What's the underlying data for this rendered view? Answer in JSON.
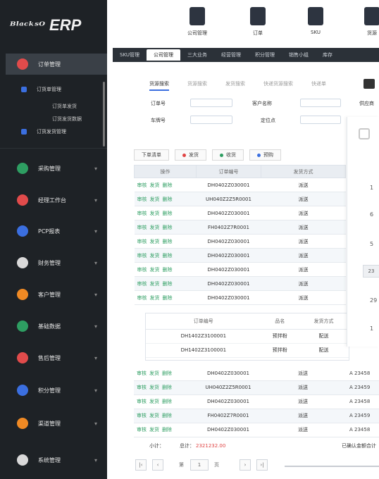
{
  "app": {
    "logo_mark": "ᴮˡᵃᶜᵏˢᴼ",
    "logo_text": "ERP"
  },
  "colors": {
    "sidebar": "#1e2226",
    "tabbar": "#2b3138",
    "accent": "#3b6fe0",
    "op_link": "#2e9e62",
    "total": "#e04444"
  },
  "sidebar": {
    "active": {
      "label": "订单管理",
      "icon": "order-icon",
      "color": "#e14b4b"
    },
    "sub_items": [
      {
        "label": "订货单管理"
      },
      {
        "label": "订货发货管理"
      }
    ],
    "sub_sub": [
      "订货单发货",
      "订货发货数据"
    ],
    "items": [
      {
        "label": "采购管理",
        "icon": "purchase-icon",
        "color": "#2e9e62"
      },
      {
        "label": "经理工作台",
        "icon": "manager-icon",
        "color": "#e14b4b"
      },
      {
        "label": "PCP报表",
        "icon": "report-icon",
        "color": "#3b6fe0"
      },
      {
        "label": "财务管理",
        "icon": "finance-icon",
        "color": "#d9d9d9"
      },
      {
        "label": "客户管理",
        "icon": "customer-icon",
        "color": "#f08a24"
      },
      {
        "label": "基础数据",
        "icon": "data-icon",
        "color": "#2e9e62"
      },
      {
        "label": "售后管理",
        "icon": "service-icon",
        "color": "#e14b4b"
      },
      {
        "label": "积分管理",
        "icon": "points-icon",
        "color": "#3b6fe0"
      },
      {
        "label": "渠道管理",
        "icon": "channel-icon",
        "color": "#f08a24"
      },
      {
        "label": "系统管理",
        "icon": "system-icon",
        "color": "#d9d9d9"
      }
    ]
  },
  "toolbar": {
    "buttons": [
      {
        "label": "公司管理",
        "icon": "company-icon"
      },
      {
        "label": "订单",
        "icon": "clipboard-icon"
      },
      {
        "label": "SKU",
        "icon": "sku-icon"
      },
      {
        "label": "货源",
        "icon": "source-icon"
      }
    ]
  },
  "tabs": [
    "SKU管理",
    "公司管理",
    "三大业务",
    "经营管理",
    "积分管理",
    "销售小组",
    "库存"
  ],
  "filter": {
    "tabs": [
      "货源搜索",
      "货源搜索",
      "发货搜索",
      "快递货源搜索",
      "快递单"
    ],
    "labels": [
      "订单号",
      "客户名称",
      "车牌号",
      "定位点",
      "供应商"
    ]
  },
  "actions": [
    {
      "label": "下单清单",
      "dot": ""
    },
    {
      "label": "发货",
      "dot": "#e04444"
    },
    {
      "label": "收货",
      "dot": "#2e9e62"
    },
    {
      "label": "预购",
      "dot": "#3b6fe0"
    }
  ],
  "table": {
    "headers": [
      "操作",
      "订单编号",
      "发货方式"
    ],
    "ops": [
      "审核",
      "发货",
      "删除"
    ],
    "rows_top": [
      {
        "id": "DH0402Z030001",
        "method": "派送"
      },
      {
        "id": "UH040Z2Z5R0001",
        "method": "派送"
      },
      {
        "id": "DH0402Z030001",
        "method": "派送"
      },
      {
        "id": "FH0402Z7R0001",
        "method": "派送"
      },
      {
        "id": "DH0402Z030001",
        "method": "派送"
      },
      {
        "id": "DH0402Z030001",
        "method": "派送"
      },
      {
        "id": "DH0402Z030001",
        "method": "派送"
      },
      {
        "id": "DH0402Z030001",
        "method": "派送"
      },
      {
        "id": "DH0402Z030001",
        "method": "派送"
      }
    ],
    "rows_bottom": [
      {
        "id": "DH0402Z030001",
        "method": "派送",
        "extra": "A 23458"
      },
      {
        "id": "UH040Z2Z5R0001",
        "method": "派送",
        "extra": "A 23459"
      },
      {
        "id": "DH0402Z030001",
        "method": "派送",
        "extra": "A 23458"
      },
      {
        "id": "FH0402Z7R0001",
        "method": "派送",
        "extra": "A 23459"
      },
      {
        "id": "DH0402Z030001",
        "method": "派送",
        "extra": "A 23458"
      }
    ]
  },
  "detail": {
    "headers": [
      "订单编号",
      "品名",
      "发货方式"
    ],
    "rows": [
      {
        "id": "DH1402Z3100001",
        "name": "预拌粉",
        "method": "配送"
      },
      {
        "id": "DH1402Z3100001",
        "name": "预拌粉",
        "method": "配送"
      }
    ]
  },
  "sidepanel": {
    "numbers": [
      "1",
      "6",
      "5",
      "23",
      "29",
      "1"
    ]
  },
  "footer": {
    "subtotal_label": "小计：",
    "total_label": "总计：",
    "total_value": "2321232.00",
    "right_text": "已确认金额合计"
  },
  "pager": {
    "page_label": "第",
    "page_value": "1",
    "page_suffix": "页"
  }
}
